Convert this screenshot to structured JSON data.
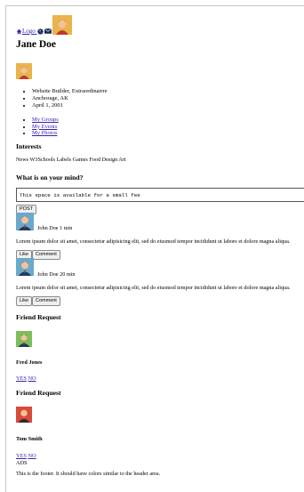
{
  "header": {
    "logo_label": "Logo",
    "icons": [
      "home-icon",
      "globe-icon",
      "envelope-icon"
    ]
  },
  "profile": {
    "name": "Jane Doe",
    "details": [
      "Website Builder, Extraordinairre",
      "Anchorage, AK",
      "April 1, 2001"
    ],
    "links": [
      "My Groups",
      "My Events",
      "My Photos"
    ]
  },
  "interests": {
    "title": "Interests",
    "text": "News W3Schools Labels Games Food Design Art"
  },
  "compose": {
    "title": "What is on your mind?",
    "value": "This space is available for a small fee",
    "post_label": "POST"
  },
  "posts": [
    {
      "author": "John Doe",
      "time": "1 min",
      "text": "Lorem ipsum dolor sit amet, consectetur adipisicing elit, sed do eiusmod tempor incididunt ut labore et dolore magna aliqua.",
      "like_label": "Like",
      "comment_label": "Comment"
    },
    {
      "author": "John Doe",
      "time": "20 min",
      "text": "Lorem ipsum dolor sit amet, consectetur adipisicing elit, sed do eiusmod tempor incididunt ut labore et dolore magna aliqua.",
      "like_label": "Like",
      "comment_label": "Comment"
    }
  ],
  "friend_requests": [
    {
      "title": "Friend Request",
      "name": "Fred Jones",
      "yes": "YES",
      "no": "NO"
    },
    {
      "title": "Friend Request",
      "name": "Tom Smith",
      "yes": "YES",
      "no": "NO"
    }
  ],
  "ads_label": "ADS",
  "footer_text": "This is the footer. It should have colors similar to the header area."
}
